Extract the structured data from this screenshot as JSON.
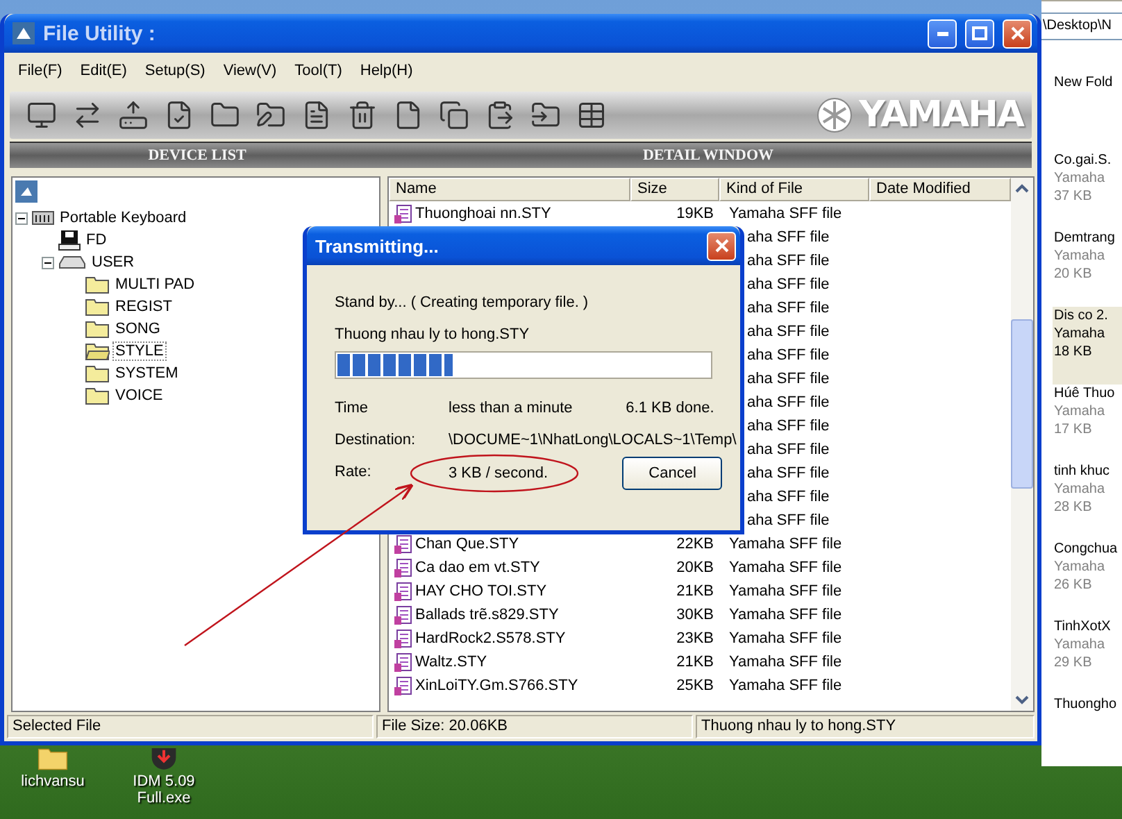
{
  "main_window": {
    "title": "File Utility :",
    "menu": [
      "File(F)",
      "Edit(E)",
      "Setup(S)",
      "View(V)",
      "Tool(T)",
      "Help(H)"
    ],
    "logo": "YAMAHA",
    "panel_headers": [
      "DEVICE LIST",
      "DETAIL WINDOW"
    ],
    "tree": [
      {
        "label": "Portable Keyboard",
        "kind": "keyboard",
        "expanded": true,
        "selected": false,
        "children": [
          {
            "label": "FD",
            "kind": "floppy",
            "selected": false
          },
          {
            "label": "USER",
            "kind": "drive",
            "expanded": true,
            "selected": false,
            "children": [
              {
                "label": "MULTI PAD",
                "kind": "folder",
                "selected": false
              },
              {
                "label": "REGIST",
                "kind": "folder",
                "selected": false
              },
              {
                "label": "SONG",
                "kind": "folder",
                "selected": false
              },
              {
                "label": "STYLE",
                "kind": "folder",
                "selected": true
              },
              {
                "label": "SYSTEM",
                "kind": "folder",
                "selected": false
              },
              {
                "label": "VOICE",
                "kind": "folder",
                "selected": false
              }
            ]
          }
        ]
      }
    ],
    "file_list": {
      "columns": [
        "Name",
        "Size",
        "Kind of File",
        "Date Modified"
      ],
      "rows": [
        {
          "kind": "full",
          "name": "Thuonghoai nn.STY",
          "size": "19KB",
          "type": "Yamaha SFF file"
        },
        {
          "kind": "covered",
          "type": "aha SFF file"
        },
        {
          "kind": "covered",
          "type": "aha SFF file"
        },
        {
          "kind": "covered",
          "type": "aha SFF file"
        },
        {
          "kind": "covered",
          "type": "aha SFF file"
        },
        {
          "kind": "covered",
          "type": "aha SFF file"
        },
        {
          "kind": "covered",
          "type": "aha SFF file"
        },
        {
          "kind": "covered",
          "type": "aha SFF file"
        },
        {
          "kind": "covered",
          "type": "aha SFF file"
        },
        {
          "kind": "covered",
          "type": "aha SFF file"
        },
        {
          "kind": "covered",
          "type": "aha SFF file"
        },
        {
          "kind": "covered",
          "type": "aha SFF file"
        },
        {
          "kind": "covered",
          "type": "aha SFF file"
        },
        {
          "kind": "covered",
          "type": "aha SFF file"
        },
        {
          "kind": "full",
          "name": "Chan Que.STY",
          "size": "22KB",
          "type": "Yamaha SFF file"
        },
        {
          "kind": "full",
          "name": "Ca dao em vt.STY",
          "size": "20KB",
          "type": "Yamaha SFF file"
        },
        {
          "kind": "full",
          "name": "HAY  CHO  TOI.STY",
          "size": "21KB",
          "type": "Yamaha SFF file"
        },
        {
          "kind": "full",
          "name": "Ballads trẽ.s829.STY",
          "size": "30KB",
          "type": "Yamaha SFF file"
        },
        {
          "kind": "full",
          "name": "HardRock2.S578.STY",
          "size": "23KB",
          "type": "Yamaha SFF file"
        },
        {
          "kind": "full",
          "name": "Waltz.STY",
          "size": "21KB",
          "type": "Yamaha SFF file"
        },
        {
          "kind": "full",
          "name": "XinLoiTY.Gm.S766.STY",
          "size": "25KB",
          "type": "Yamaha SFF file"
        }
      ]
    },
    "status_bar": [
      "Selected File",
      "File Size: 20.06KB",
      "Thuong nhau ly to hong.STY"
    ]
  },
  "dialog": {
    "title": "Transmitting...",
    "status": "Stand by... ( Creating temporary file. )",
    "file": "Thuong nhau ly to hong.STY",
    "progress": {
      "level": 0.31
    },
    "time_label": "Time",
    "time_value": "less than a minute",
    "done": "6.1 KB done.",
    "destination_label": "Destination:",
    "destination_value": "\\DOCUME~1\\NhatLong\\LOCALS~1\\Temp\\",
    "rate_label": "Rate:",
    "rate_value": "3 KB / second.",
    "button": "Cancel"
  },
  "explorer": {
    "address": "\\Desktop\\N",
    "items": [
      {
        "name": "New Fold",
        "selected": false
      },
      {
        "name": "Co.gai.S.",
        "type": "Yamaha",
        "size": "37 KB",
        "selected": false
      },
      {
        "name": "Demtrang",
        "type": "Yamaha",
        "size": "20 KB",
        "selected": false
      },
      {
        "name": "Dis co 2.",
        "type": "Yamaha",
        "size": "18 KB",
        "selected": true
      },
      {
        "name": "Húê Thuo",
        "type": "Yamaha",
        "size": "17 KB",
        "selected": false
      },
      {
        "name": "tinh khuc",
        "type": "Yamaha",
        "size": "28 KB",
        "selected": false
      },
      {
        "name": "Congchua",
        "type": "Yamaha",
        "size": "26 KB",
        "selected": false
      },
      {
        "name": "TinhXotX",
        "type": "Yamaha",
        "size": "29 KB",
        "selected": false
      },
      {
        "name": "Thuongho",
        "selected": false
      }
    ]
  },
  "desktop_icons": [
    {
      "label": "lichvansu",
      "kind": "folder"
    },
    {
      "label": "IDM 5.09 Full.exe",
      "kind": "app"
    }
  ]
}
